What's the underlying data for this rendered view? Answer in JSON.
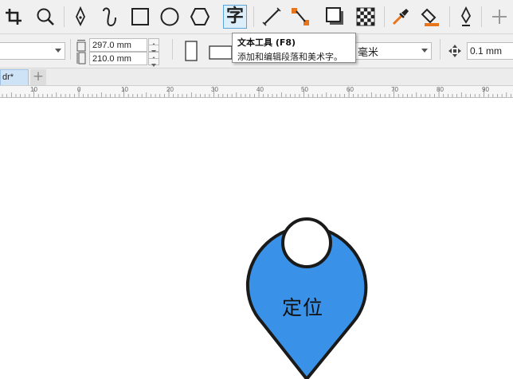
{
  "toolbar": {
    "text_tool_glyph": "字",
    "colors": {
      "accent": "#e8741c",
      "active_bg": "#dbeefa"
    }
  },
  "tooltip": {
    "title": "文本工具 (F8)",
    "description": "添加和编辑段落和美术字。"
  },
  "property_bar": {
    "width_value": "297.0 mm",
    "height_value": "210.0 mm",
    "units_value": "毫米",
    "nudge_value": "0.1 mm"
  },
  "tabs": {
    "document_tab_label": "dr*",
    "add_tab_label": "+"
  },
  "ruler": {
    "labels": [
      "10",
      "0",
      "10",
      "20",
      "30",
      "40",
      "50",
      "60",
      "70",
      "80",
      "90"
    ]
  },
  "canvas": {
    "caption": "定位",
    "pin_fill": "#3a92e8",
    "pin_stroke": "#1a1a1a"
  }
}
